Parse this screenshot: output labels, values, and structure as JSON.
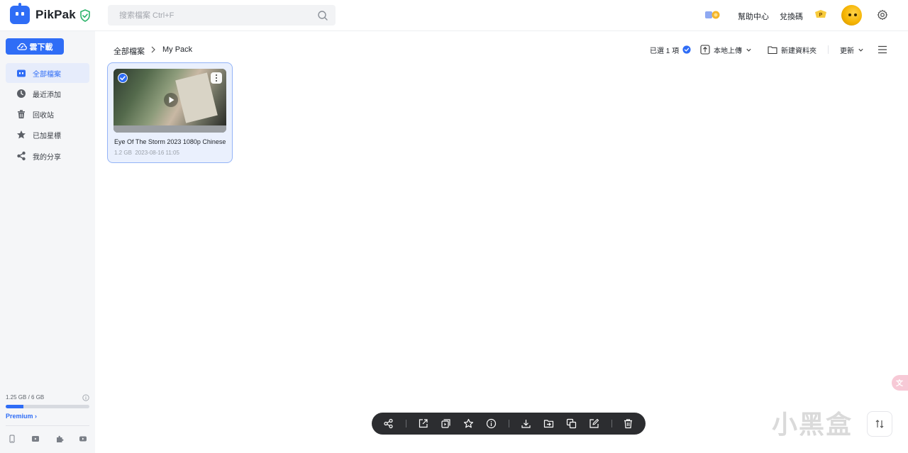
{
  "header": {
    "brand": "PikPak",
    "search_placeholder": "搜索檔案 Ctrl+F",
    "help_label": "幫助中心",
    "redeem_label": "兌換碼"
  },
  "sidebar": {
    "cloud_download_label": "雲下載",
    "items": [
      {
        "label": "全部檔案",
        "icon": "folder-icon",
        "active": true
      },
      {
        "label": "最近添加",
        "icon": "clock-icon",
        "active": false
      },
      {
        "label": "回收站",
        "icon": "trash-icon",
        "active": false
      },
      {
        "label": "已加星標",
        "icon": "star-icon",
        "active": false
      },
      {
        "label": "我的分享",
        "icon": "share-icon",
        "active": false
      }
    ],
    "storage_text": "1.25 GB / 6 GB",
    "storage_fraction": 0.208,
    "premium_label": "Premium",
    "footer_icons": [
      "phone-icon",
      "tv-icon",
      "extension-icon",
      "youtube-icon"
    ]
  },
  "toolbar": {
    "breadcrumb": [
      "全部檔案",
      "My Pack"
    ],
    "selected_label": "已選 1 項",
    "upload_label": "本地上傳",
    "new_folder_label": "新建資料夾",
    "sort_label": "更新"
  },
  "files": [
    {
      "name": "Eye Of The Storm 2023 1080p Chinese",
      "size": "1.2 GB",
      "date": "2023-08-16 11:05",
      "selected": true
    }
  ],
  "action_bar": {
    "actions": [
      "share-icon",
      "open-external-icon",
      "play-list-icon",
      "star-icon",
      "info-icon",
      "download-icon",
      "move-icon",
      "copy-icon",
      "rename-icon",
      "delete-icon"
    ]
  },
  "watermark": "小黑盒",
  "colors": {
    "accent": "#2f6df6",
    "sidebar_bg": "#f5f6f8",
    "action_bar_bg": "#2c2d30",
    "shield_green": "#2cb36a"
  }
}
